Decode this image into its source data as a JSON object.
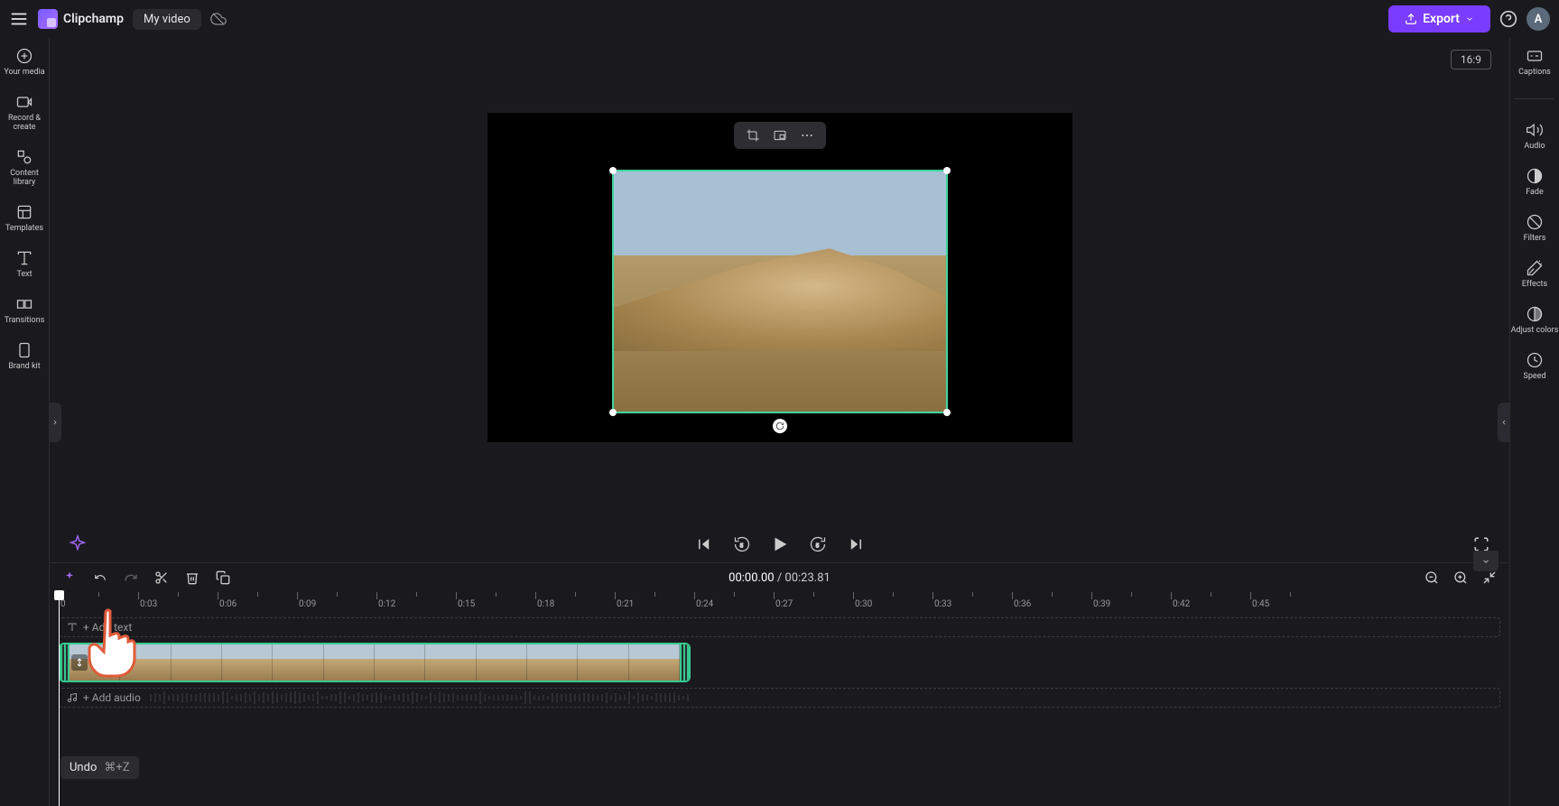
{
  "app": {
    "name": "Clipchamp",
    "project_title": "My video"
  },
  "header": {
    "export_label": "Export",
    "aspect_ratio": "16:9",
    "avatar_initial": "A"
  },
  "left_sidebar": {
    "items": [
      {
        "label": "Your media",
        "icon": "plus-circle-icon"
      },
      {
        "label": "Record & create",
        "icon": "camera-icon"
      },
      {
        "label": "Content library",
        "icon": "shapes-icon"
      },
      {
        "label": "Templates",
        "icon": "template-icon"
      },
      {
        "label": "Text",
        "icon": "text-icon"
      },
      {
        "label": "Transitions",
        "icon": "transitions-icon"
      },
      {
        "label": "Brand kit",
        "icon": "brand-kit-icon"
      }
    ]
  },
  "right_sidebar": {
    "items": [
      {
        "label": "Captions",
        "icon": "captions-icon"
      },
      {
        "label": "Audio",
        "icon": "speaker-icon"
      },
      {
        "label": "Fade",
        "icon": "fade-icon"
      },
      {
        "label": "Filters",
        "icon": "filters-icon"
      },
      {
        "label": "Effects",
        "icon": "effects-icon"
      },
      {
        "label": "Adjust colors",
        "icon": "adjust-colors-icon"
      },
      {
        "label": "Speed",
        "icon": "speed-icon"
      }
    ]
  },
  "tooltip": {
    "label": "Undo",
    "shortcut": "⌘+Z"
  },
  "playback": {
    "current_time": "00:00.00",
    "separator": "/",
    "duration": "00:23.81"
  },
  "timeline": {
    "start_label": "0",
    "ticks": [
      "0:03",
      "0:06",
      "0:09",
      "0:12",
      "0:15",
      "0:18",
      "0:21",
      "0:24",
      "0:27",
      "0:30",
      "0:33",
      "0:36",
      "0:39",
      "0:42",
      "0:45"
    ],
    "text_track_label": "+ Add text",
    "audio_track_label": "+ Add audio"
  },
  "colors": {
    "accent": "#7a3dff",
    "selection": "#34c98f"
  }
}
